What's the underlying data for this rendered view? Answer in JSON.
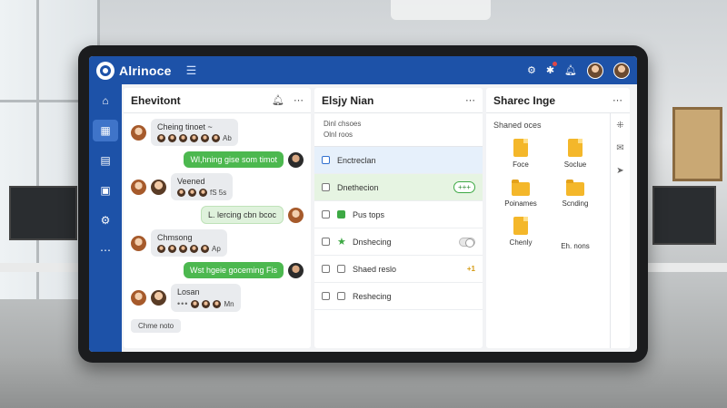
{
  "app": {
    "title": "Alrinoce"
  },
  "topbar": {
    "menu_icon": "menu-lines-icon",
    "icons": [
      "settings-icon",
      "notifications-icon",
      "bell-icon"
    ]
  },
  "sidebar": {
    "items": [
      "home-icon",
      "grid-icon",
      "document-icon",
      "calendar-icon",
      "settings-icon",
      "more-icon"
    ]
  },
  "chat": {
    "title": "Ehevitont",
    "messages": [
      {
        "side": "left",
        "text": "Cheing tinoet ~",
        "people_label": "Ab"
      },
      {
        "side": "right",
        "text": "Wl,hning gise som timot",
        "style": "green"
      },
      {
        "side": "left",
        "text": "Veened",
        "people_label": "fS 5s"
      },
      {
        "side": "right",
        "text": "L. lercing cbn bcoc",
        "style": "light-green"
      },
      {
        "side": "left",
        "text": "Chmsong",
        "people_label": "Ap"
      },
      {
        "side": "right",
        "text": "Wst hgeie goceming Fis",
        "style": "green"
      },
      {
        "side": "left",
        "text": "Losan",
        "people_label": "Mn"
      }
    ],
    "chip": "Chme noto"
  },
  "tasks": {
    "title": "Elsjy Nian",
    "header_lines": [
      "Dinl chsoes",
      "Olnl roos"
    ],
    "items": [
      {
        "label": "Enctreclan",
        "style": "blue"
      },
      {
        "label": "Dnethecion",
        "style": "green",
        "badge": "+++"
      },
      {
        "label": "Pus tops"
      },
      {
        "label": "Dnshecing"
      },
      {
        "label": "Shaed reslo",
        "tag": "+1"
      },
      {
        "label": "Reshecing"
      }
    ]
  },
  "files": {
    "title": "Sharec Inge",
    "subtitle": "Shaned oces",
    "items": [
      {
        "label": "Foce",
        "kind": "doc"
      },
      {
        "label": "Soclue",
        "kind": "doc"
      },
      {
        "label": "Poinames",
        "kind": "folder"
      },
      {
        "label": "Scnding",
        "kind": "folder"
      },
      {
        "label": "Chenly",
        "kind": "doc"
      },
      {
        "label": "Eh. nons",
        "kind": "none"
      }
    ]
  },
  "colors": {
    "brand": "#1d52a8",
    "accent_green": "#4cb84f",
    "file_yellow": "#f4b72a"
  }
}
